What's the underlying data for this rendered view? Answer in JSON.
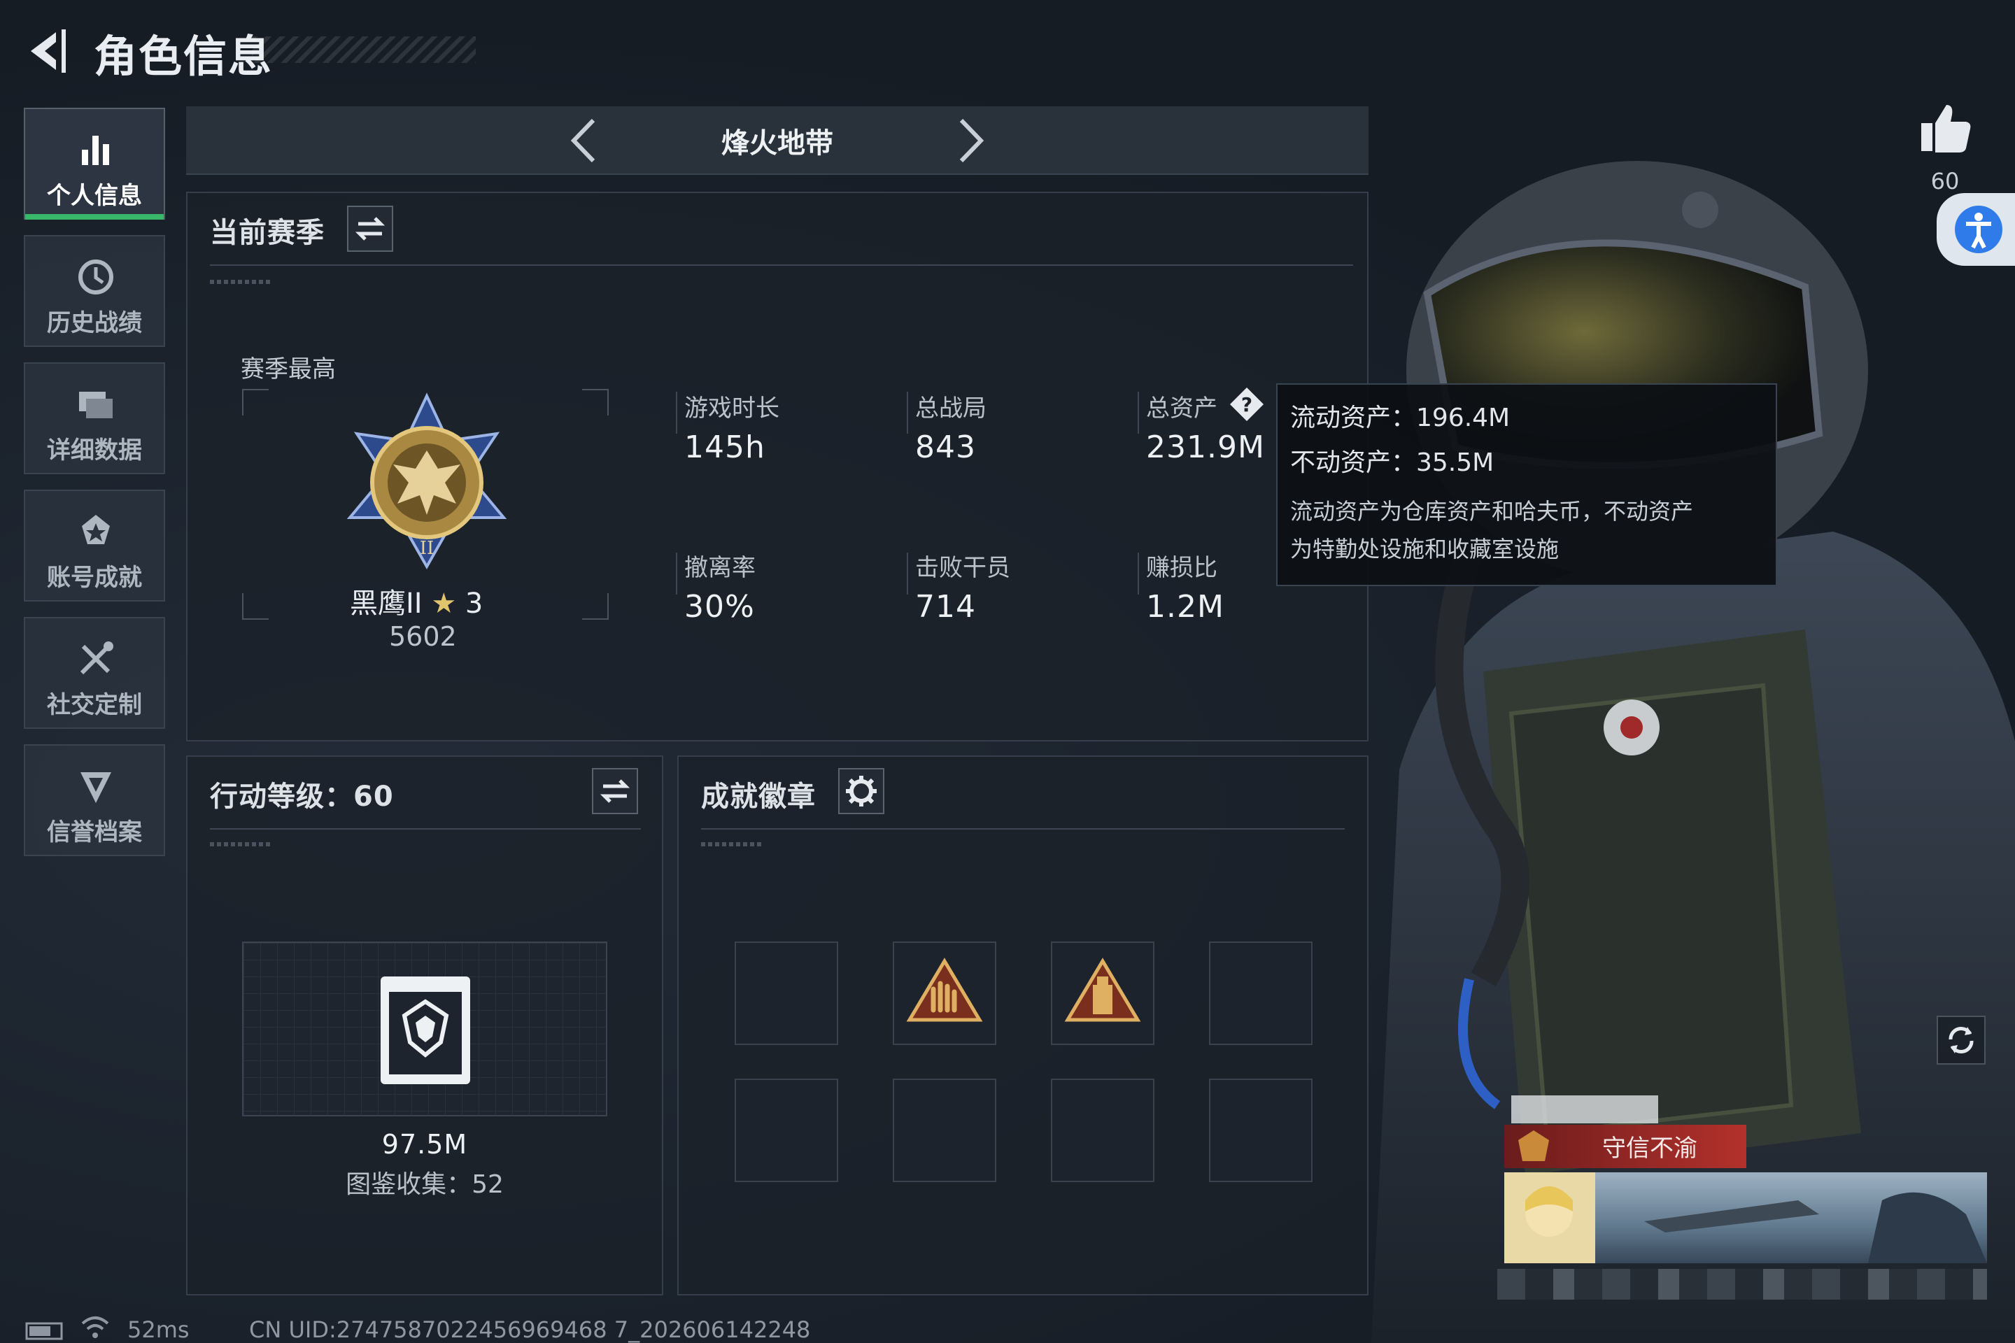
{
  "header": {
    "title": "角色信息"
  },
  "sidebar": {
    "items": [
      {
        "label": "个人信息",
        "icon": "bar-chart-icon",
        "active": true
      },
      {
        "label": "历史战绩",
        "icon": "history-clock-icon",
        "active": false
      },
      {
        "label": "详细数据",
        "icon": "data-cards-icon",
        "active": false
      },
      {
        "label": "账号成就",
        "icon": "achievement-star-icon",
        "active": false
      },
      {
        "label": "社交定制",
        "icon": "tools-icon",
        "active": false
      },
      {
        "label": "信誉档案",
        "icon": "credit-shield-icon",
        "active": false
      }
    ]
  },
  "mode_bar": {
    "title": "烽火地带"
  },
  "season": {
    "title": "当前赛季",
    "top_label": "赛季最高",
    "rank_name": "黑鹰II",
    "rank_stars": "3",
    "rank_score": "5602",
    "stats": [
      {
        "label": "游戏时长",
        "value": "145h"
      },
      {
        "label": "总战局",
        "value": "843"
      },
      {
        "label": "总资产",
        "value": "231.9M"
      },
      {
        "label": "撤离率",
        "value": "30%"
      },
      {
        "label": "击败干员",
        "value": "714"
      },
      {
        "label": "赚损比",
        "value": "1.2M"
      }
    ]
  },
  "tooltip": {
    "liquid": "流动资产：196.4M",
    "fixed": "不动资产：35.5M",
    "desc_line1": "流动资产为仓库资产和哈夫币，不动资产",
    "desc_line2": "为特勤处设施和收藏室设施"
  },
  "action_level": {
    "title": "行动等级：60",
    "value": "97.5M",
    "collection": "图鉴收集：52"
  },
  "badges": {
    "title": "成就徽章",
    "slots": [
      "empty",
      "hand-sign-badge",
      "tower-badge",
      "empty",
      "empty",
      "empty",
      "empty",
      "empty"
    ]
  },
  "character": {
    "like_count": "60",
    "card_title": "守信不渝"
  },
  "status_bar": {
    "ping": "52ms",
    "uid": "CN UID:2747587022456969468 7_202606142248"
  },
  "colors": {
    "accent_green": "#39b86a",
    "background": "#1a2029",
    "card_red": "#b3312c"
  }
}
